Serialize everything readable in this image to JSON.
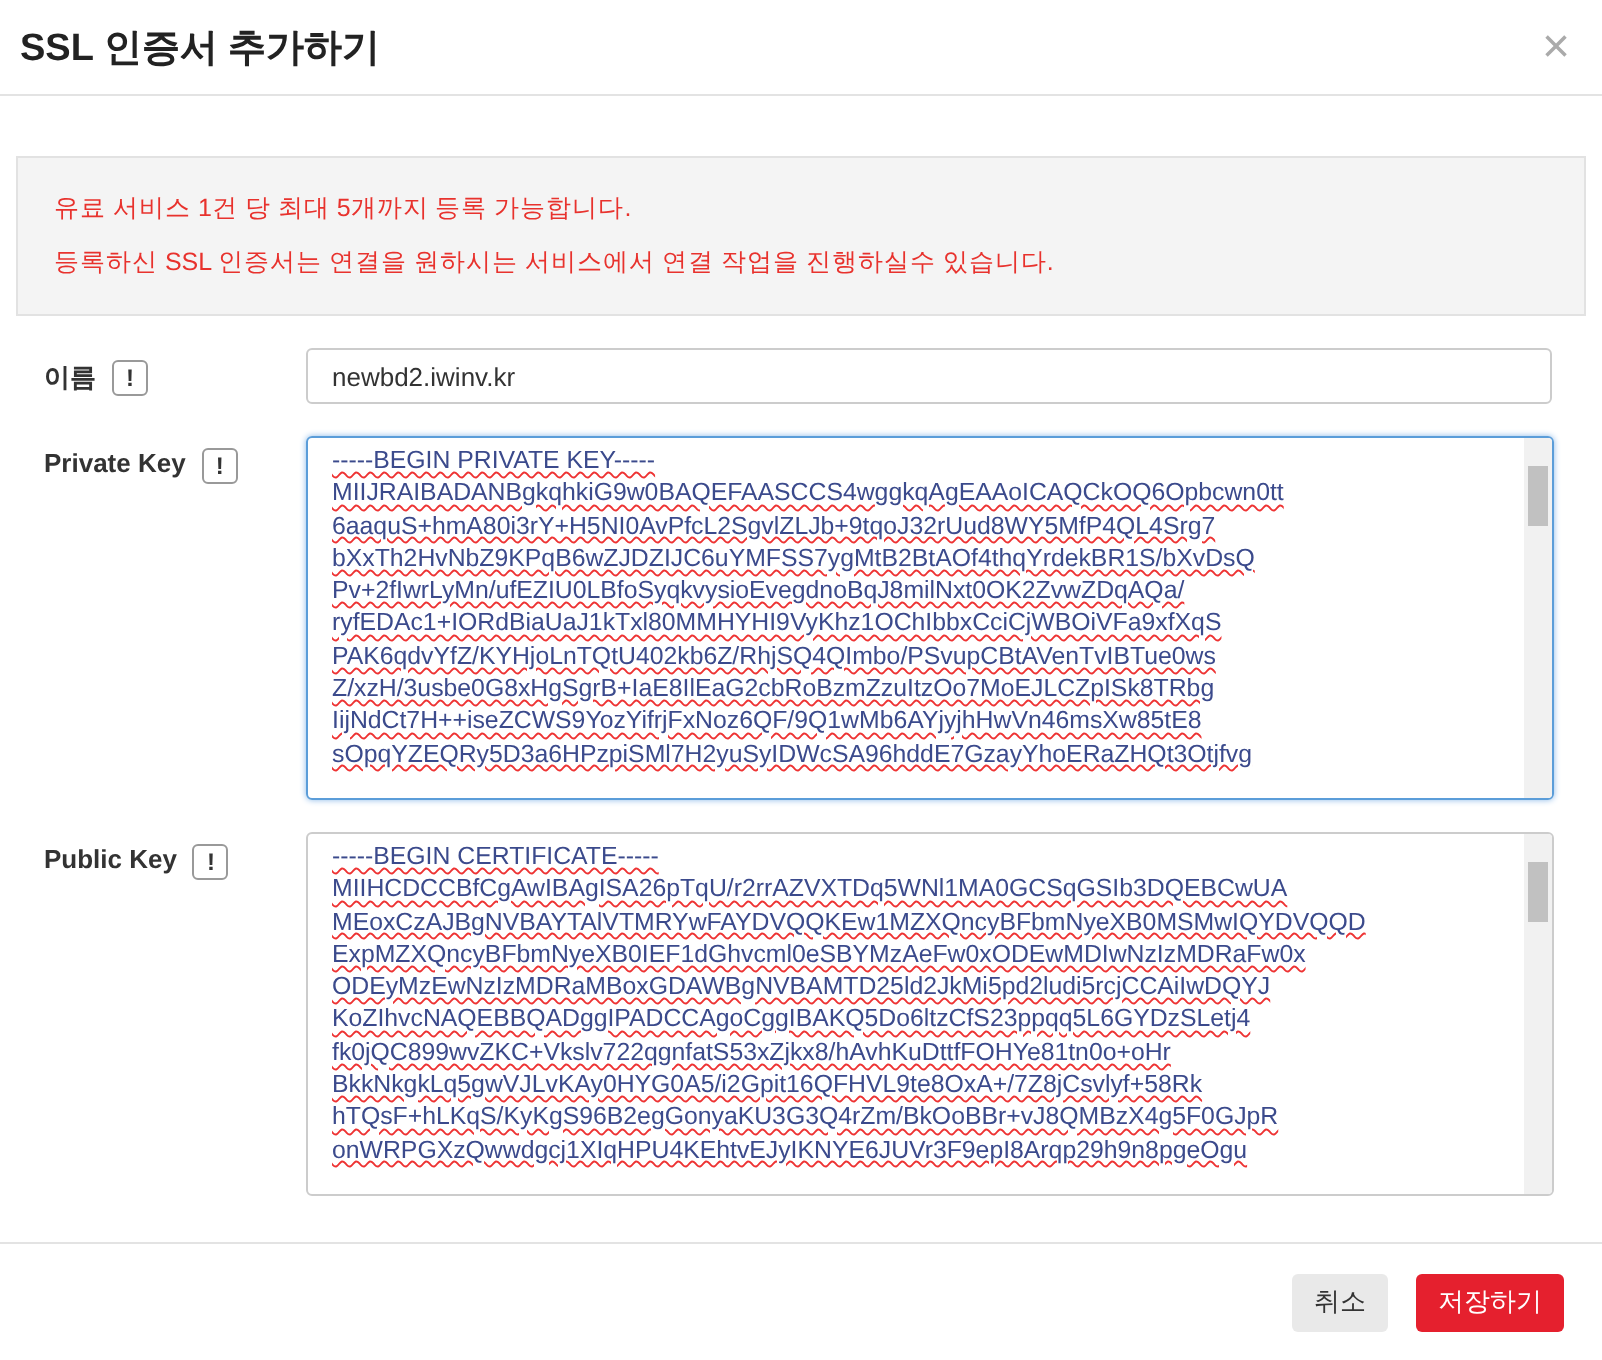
{
  "dialog": {
    "title": "SSL 인증서 추가하기",
    "close": "×"
  },
  "notice": [
    "유료 서비스 1건 당 최대 5개까지 등록 가능합니다.",
    "등록하신 SSL 인증서는 연결을 원하시는 서비스에서 연결 작업을 진행하실수 있습니다."
  ],
  "fields": [
    {
      "kind": "input",
      "label": "이름",
      "help": "!",
      "value": "newbd2.iwinv.kr",
      "focused": false
    },
    {
      "kind": "textarea",
      "label": "Private Key",
      "help": "!",
      "focused": true,
      "lines": [
        "-----BEGIN PRIVATE KEY-----",
        "MIIJRAIBADANBgkqhkiG9w0BAQEFAASCCS4wggkqAgEAAoICAQCkOQ6Opbcwn0tt",
        "6aaquS+hmA80i3rY+H5NI0AvPfcL2SgvlZLJb+9tqoJ32rUud8WY5MfP4QL4Srg7",
        "bXxTh2HvNbZ9KPqB6wZJDZIJC6uYMFSS7ygMtB2BtAOf4thqYrdekBR1S/bXvDsQ",
        "Pv+2fIwrLyMn/ufEZIU0LBfoSyqkvysioEvegdnoBqJ8milNxt0OK2ZvwZDqAQa/",
        "ryfEDAc1+IORdBiaUaJ1kTxl80MMHYHI9VyKhz1OChIbbxCciCjWBOiVFa9xfXqS",
        "PAK6qdvYfZ/KYHjoLnTQtU402kb6Z/RhjSQ4QImbo/PSvupCBtAVenTvIBTue0ws",
        "Z/xzH/3usbe0G8xHgSgrB+IaE8IlEaG2cbRoBzmZzuItzOo7MoEJLCZpISk8TRbg",
        "IijNdCt7H++iseZCWS9YozYifrjFxNoz6QF/9Q1wMb6AYjyjhHwVn46msXw85tE8",
        "sOpqYZEQRy5D3a6HPzpiSMl7H2yuSyIDWcSA96hddE7GzayYhoERaZHQt3Otjfvg"
      ]
    },
    {
      "kind": "textarea",
      "label": "Public Key",
      "help": "!",
      "focused": false,
      "lines": [
        "-----BEGIN CERTIFICATE-----",
        "MIIHCDCCBfCgAwIBAgISA26pTqU/r2rrAZVXTDq5WNl1MA0GCSqGSIb3DQEBCwUA",
        "MEoxCzAJBgNVBAYTAlVTMRYwFAYDVQQKEw1MZXQncyBFbmNyeXB0MSMwIQYDVQQD",
        "ExpMZXQncyBFbmNyeXB0IEF1dGhvcml0eSBYMzAeFw0xODEwMDIwNzIzMDRaFw0x",
        "ODEyMzEwNzIzMDRaMBoxGDAWBgNVBAMTD25ld2JkMi5pd2ludi5rcjCCAiIwDQYJ",
        "KoZIhvcNAQEBBQADggIPADCCAgoCggIBAKQ5Do6ltzCfS23ppqq5L6GYDzSLetj4",
        "fk0jQC899wvZKC+Vkslv722qgnfatS53xZjkx8/hAvhKuDttfFOHYe81tn0o+oHr",
        "BkkNkgkLq5gwVJLvKAy0HYG0A5/i2Gpit16QFHVL9te8OxA+/7Z8jCsvlyf+58Rk",
        "hTQsF+hLKqS/KyKgS96B2egGonyaKU3G3Q4rZm/BkOoBBr+vJ8QMBzX4g5F0GJpR",
        "onWRPGXzQwwdgcj1XIqHPU4KEhtvEJyIKNYE6JUVr3F9epI8Arqp29h9n8pgeOgu"
      ]
    }
  ],
  "buttons": [
    {
      "kind": "secondary",
      "label": "취소"
    },
    {
      "kind": "primary",
      "label": "저장하기"
    }
  ]
}
